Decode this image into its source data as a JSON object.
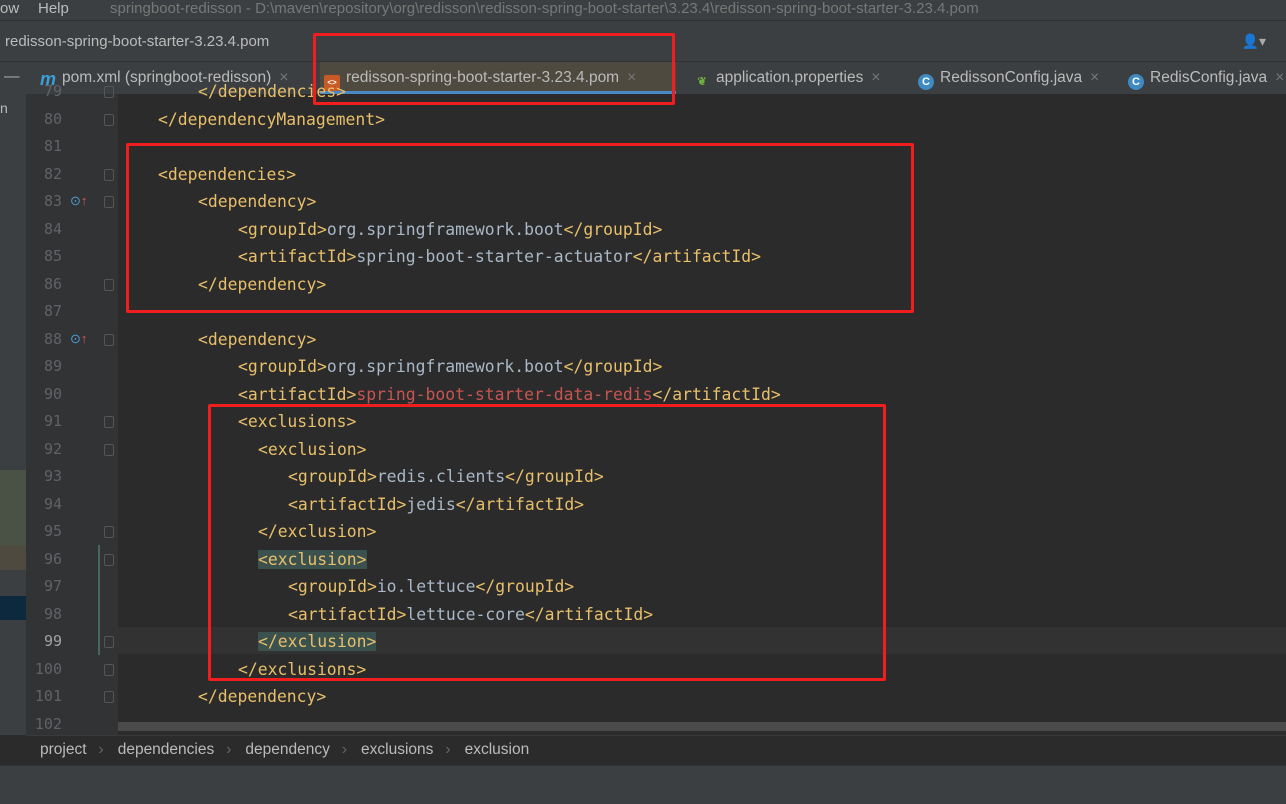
{
  "menu": {
    "window_partial": "ow",
    "help": "Help",
    "title": "springboot-redisson - D:\\maven\\repository\\org\\redisson\\redisson-spring-boot-starter\\3.23.4\\redisson-spring-boot-starter-3.23.4.pom"
  },
  "navbar": {
    "file": "redisson-spring-boot-starter-3.23.4.pom",
    "user_icon": "user-icon"
  },
  "tabs": [
    {
      "label": "pom.xml (springboot-redisson)",
      "icon": "maven-icon",
      "active": false
    },
    {
      "label": "redisson-spring-boot-starter-3.23.4.pom",
      "icon": "xml-file-icon",
      "active": true
    },
    {
      "label": "application.properties",
      "icon": "spring-leaf-icon",
      "active": false
    },
    {
      "label": "RedissonConfig.java",
      "icon": "java-class-icon",
      "active": false
    },
    {
      "label": "RedisConfig.java",
      "icon": "java-class-icon",
      "active": false
    }
  ],
  "left_strip_text": "n",
  "code_lines": [
    {
      "n": "79",
      "indent": 8,
      "parts": [
        [
          "tag",
          "</dependencies>"
        ]
      ]
    },
    {
      "n": "80",
      "indent": 4,
      "parts": [
        [
          "tag",
          "</dependencyManagement>"
        ]
      ]
    },
    {
      "n": "81",
      "indent": 0,
      "parts": []
    },
    {
      "n": "82",
      "indent": 4,
      "parts": [
        [
          "tag",
          "<dependencies>"
        ]
      ]
    },
    {
      "n": "83",
      "indent": 8,
      "parts": [
        [
          "tag",
          "<dependency>"
        ]
      ]
    },
    {
      "n": "84",
      "indent": 12,
      "parts": [
        [
          "tag",
          "<groupId>"
        ],
        [
          "txt",
          "org.springframework.boot"
        ],
        [
          "tag",
          "</groupId>"
        ]
      ]
    },
    {
      "n": "85",
      "indent": 12,
      "parts": [
        [
          "tag",
          "<artifactId>"
        ],
        [
          "txt",
          "spring-boot-starter-actuator"
        ],
        [
          "tag",
          "</artifactId>"
        ]
      ]
    },
    {
      "n": "86",
      "indent": 8,
      "parts": [
        [
          "tag",
          "</dependency>"
        ]
      ]
    },
    {
      "n": "87",
      "indent": 0,
      "parts": []
    },
    {
      "n": "88",
      "indent": 8,
      "parts": [
        [
          "tag",
          "<dependency>"
        ]
      ]
    },
    {
      "n": "89",
      "indent": 12,
      "parts": [
        [
          "tag",
          "<groupId>"
        ],
        [
          "txt",
          "org.springframework.boot"
        ],
        [
          "tag",
          "</groupId>"
        ]
      ]
    },
    {
      "n": "90",
      "indent": 12,
      "parts": [
        [
          "tag",
          "<artifactId>"
        ],
        [
          "err",
          "spring-boot-starter-data-redis"
        ],
        [
          "tag",
          "</artifactId>"
        ]
      ]
    },
    {
      "n": "91",
      "indent": 12,
      "parts": [
        [
          "tag",
          "<exclusions>"
        ]
      ]
    },
    {
      "n": "92",
      "indent": 14,
      "parts": [
        [
          "tag",
          "<exclusion>"
        ]
      ]
    },
    {
      "n": "93",
      "indent": 17,
      "parts": [
        [
          "tag",
          "<groupId>"
        ],
        [
          "txt",
          "redis.clients"
        ],
        [
          "tag",
          "</groupId>"
        ]
      ]
    },
    {
      "n": "94",
      "indent": 17,
      "parts": [
        [
          "tag",
          "<artifactId>"
        ],
        [
          "txt",
          "jedis"
        ],
        [
          "tag",
          "</artifactId>"
        ]
      ]
    },
    {
      "n": "95",
      "indent": 14,
      "parts": [
        [
          "tag",
          "</exclusion>"
        ]
      ]
    },
    {
      "n": "96",
      "indent": 14,
      "parts": [
        [
          "tag hl",
          "<exclusion>"
        ]
      ]
    },
    {
      "n": "97",
      "indent": 17,
      "parts": [
        [
          "tag",
          "<groupId>"
        ],
        [
          "txt",
          "io.lettuce"
        ],
        [
          "tag",
          "</groupId>"
        ]
      ]
    },
    {
      "n": "98",
      "indent": 17,
      "parts": [
        [
          "tag",
          "<artifactId>"
        ],
        [
          "txt",
          "lettuce-core"
        ],
        [
          "tag",
          "</artifactId>"
        ]
      ]
    },
    {
      "n": "99",
      "indent": 14,
      "parts": [
        [
          "tag hl",
          "</exclusion>"
        ]
      ]
    },
    {
      "n": "100",
      "indent": 12,
      "parts": [
        [
          "tag",
          "</exclusions>"
        ]
      ]
    },
    {
      "n": "101",
      "indent": 8,
      "parts": [
        [
          "tag",
          "</dependency>"
        ]
      ]
    },
    {
      "n": "102",
      "indent": 0,
      "parts": []
    }
  ],
  "breadcrumb": [
    "project",
    "dependencies",
    "dependency",
    "exclusions",
    "exclusion"
  ],
  "colors": {
    "annotation_box": "#f01e1e",
    "xml_tag": "#e8bf6a",
    "unresolved": "#c75450"
  }
}
